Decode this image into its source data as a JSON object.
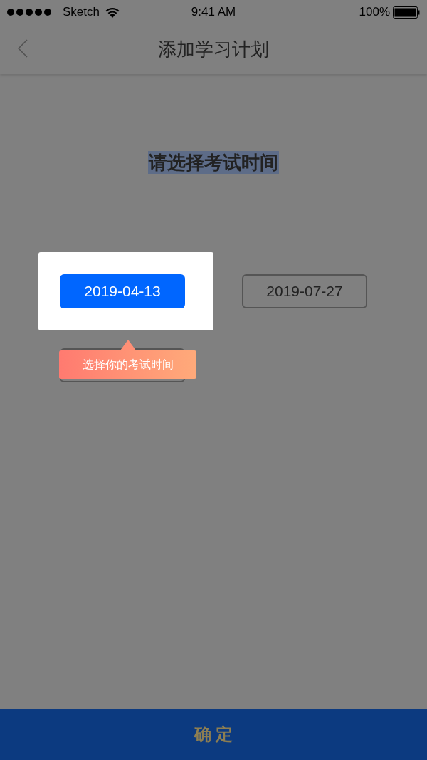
{
  "status_bar": {
    "carrier": "Sketch",
    "time": "9:41 AM",
    "battery": "100%"
  },
  "nav": {
    "title": "添加学习计划"
  },
  "prompt": "请选择考试时间",
  "dates": [
    {
      "kind": "highlighted",
      "label": "2019-04-13"
    },
    {
      "kind": "plain",
      "label": "2019-07-27"
    },
    {
      "kind": "covered"
    }
  ],
  "tooltip": "选择你的考试时间",
  "confirm_button": "确 定"
}
